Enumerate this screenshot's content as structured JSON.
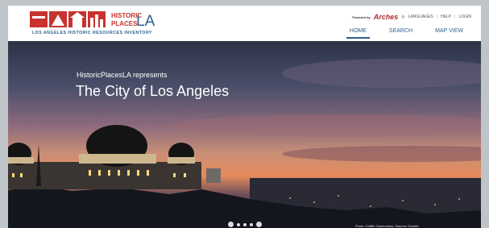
{
  "brand": {
    "name_line1": "HISTORIC",
    "name_line2": "PLACES",
    "name_suffix": "LA",
    "subtitle": "LOS ANGELES HISTORIC RESOURCES INVENTORY",
    "colors": {
      "red": "#c8322f",
      "blue": "#2b5f8d"
    }
  },
  "topbar": {
    "powered_by": "Powered by",
    "arches": "Arches",
    "languages": "LANGUAGES",
    "help": "HELP",
    "login": "LOGIN",
    "globe_icon": "globe-icon"
  },
  "nav": {
    "items": [
      {
        "label": "HOME",
        "active": true
      },
      {
        "label": "SEARCH",
        "active": false
      },
      {
        "label": "MAP VIEW",
        "active": false
      }
    ]
  },
  "hero": {
    "tagline": "HistoricPlacesLA represents",
    "headline": "The City of Los Angeles",
    "credit": "Photo: Griffith Observatory, Stephen Schafer",
    "slides": 5,
    "active_slide": 5
  }
}
